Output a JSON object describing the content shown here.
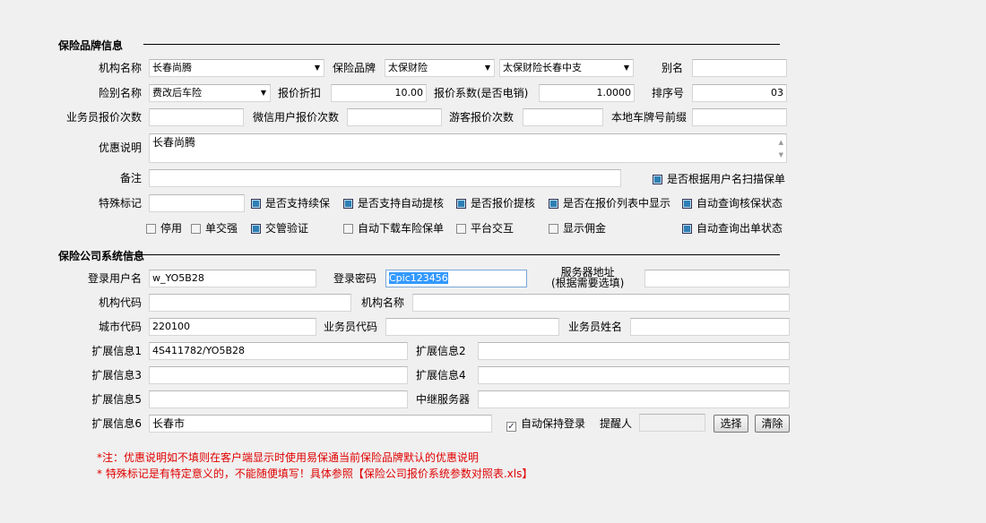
{
  "brand": {
    "title": "保险品牌信息",
    "org_label": "机构名称",
    "org_value": "长春尚腾",
    "brand_label": "保险品牌",
    "brand_value": "太保财险",
    "branch_value": "太保财险长春中支",
    "alias_label": "别名",
    "alias_value": "",
    "type_label": "险别名称",
    "type_value": "费改后车险",
    "discount_label": "报价折扣",
    "discount_value": "10.00",
    "coef_label": "报价系数(是否电销)",
    "coef_value": "1.0000",
    "order_label": "排序号",
    "order_value": "03",
    "agent_count_label": "业务员报价次数",
    "wechat_count_label": "微信用户报价次数",
    "guest_count_label": "游客报价次数",
    "plate_prefix_label": "本地车牌号前缀",
    "promo_label": "优惠说明",
    "promo_value": "长春尚腾",
    "remark_label": "备注",
    "scan_label": "是否根据用户名扫描保单",
    "special_label": "特殊标记",
    "checks1": [
      {
        "label": "是否支持续保",
        "checked": true
      },
      {
        "label": "是否支持自动提核",
        "checked": true
      },
      {
        "label": "是否报价提核",
        "checked": true
      },
      {
        "label": "是否在报价列表中显示",
        "checked": true
      },
      {
        "label": "自动查询核保状态",
        "checked": true
      }
    ],
    "checks2": [
      {
        "label": "停用",
        "checked": false
      },
      {
        "label": "单交强",
        "checked": false
      },
      {
        "label": "交管验证",
        "checked": true
      },
      {
        "label": "自动下载车险保单",
        "checked": false
      },
      {
        "label": "平台交互",
        "checked": false
      },
      {
        "label": "显示佣金",
        "checked": false
      },
      {
        "label": "自动查询出单状态",
        "checked": true
      }
    ]
  },
  "system": {
    "title": "保险公司系统信息",
    "user_label": "登录用户名",
    "user_value": "w_YO5B28",
    "pwd_label": "登录密码",
    "pwd_value": "Cpic123456",
    "server_label": "服务器地址",
    "server_hint": "(根据需要选填)",
    "orgcode_label": "机构代码",
    "orgname_label": "机构名称",
    "city_label": "城市代码",
    "city_value": "220100",
    "agentcode_label": "业务员代码",
    "agentname_label": "业务员姓名",
    "ext1_label": "扩展信息1",
    "ext1_value": "4S411782/YO5B28",
    "ext2_label": "扩展信息2",
    "ext3_label": "扩展信息3",
    "ext4_label": "扩展信息4",
    "ext5_label": "扩展信息5",
    "relay_label": "中继服务器",
    "ext6_label": "扩展信息6",
    "ext6_value": "长春市",
    "keep_login_label": "自动保持登录",
    "reminder_label": "提醒人",
    "select_btn": "选择",
    "clear_btn": "清除"
  },
  "notes": [
    "*注：优惠说明如不填则在客户端显示时使用易保通当前保险品牌默认的优惠说明",
    "* 特殊标记是有特定意义的，不能随便填写！具体参照【保险公司报价系统参数对照表.xls】"
  ]
}
